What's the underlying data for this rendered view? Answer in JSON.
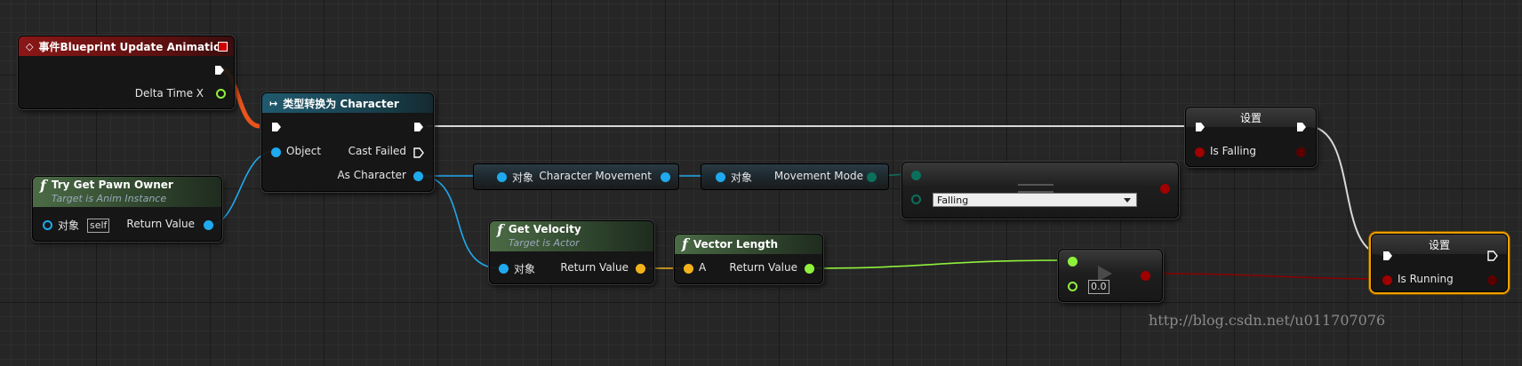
{
  "event_node": {
    "title": "事件Blueprint Update Animation",
    "pin_delta": "Delta Time X"
  },
  "cast_node": {
    "title": "类型转换为 Character",
    "pin_object": "Object",
    "pin_cast_failed": "Cast Failed",
    "pin_as_character": "As Character"
  },
  "pawn_owner_node": {
    "title": "Try Get Pawn Owner",
    "subtitle": "Target is Anim Instance",
    "pin_target": "对象",
    "self_label": "self",
    "pin_return": "Return Value"
  },
  "char_movement_node": {
    "pin_target": "对象",
    "pin_out": "Character Movement"
  },
  "movement_mode_node": {
    "pin_target": "对象",
    "pin_out": "Movement Mode"
  },
  "equal_enum_node": {
    "selected": "Falling"
  },
  "velocity_node": {
    "title": "Get Velocity",
    "subtitle": "Target is Actor",
    "pin_target": "对象",
    "pin_return": "Return Value"
  },
  "vector_length_node": {
    "title": "Vector Length",
    "pin_a": "A",
    "pin_return": "Return Value"
  },
  "greater_node": {
    "value": "0.0"
  },
  "set_falling_node": {
    "title": "设置",
    "pin_var": "Is Falling"
  },
  "set_running_node": {
    "title": "设置",
    "pin_var": "Is Running"
  },
  "watermark": "http://blog.csdn.net/u011707076",
  "colors": {
    "exec": "#ffffff",
    "object": "#1fa9ee",
    "vector": "#f2b21b",
    "float": "#8ff03c",
    "enum": "#0b6f5c",
    "bool": "#a00000",
    "selected": "#f0a000"
  },
  "icons": [
    "event-diamond-icon",
    "cast-arrow-icon",
    "function-f-icon",
    "delegate-square-icon",
    "exec-arrow-icon"
  ]
}
